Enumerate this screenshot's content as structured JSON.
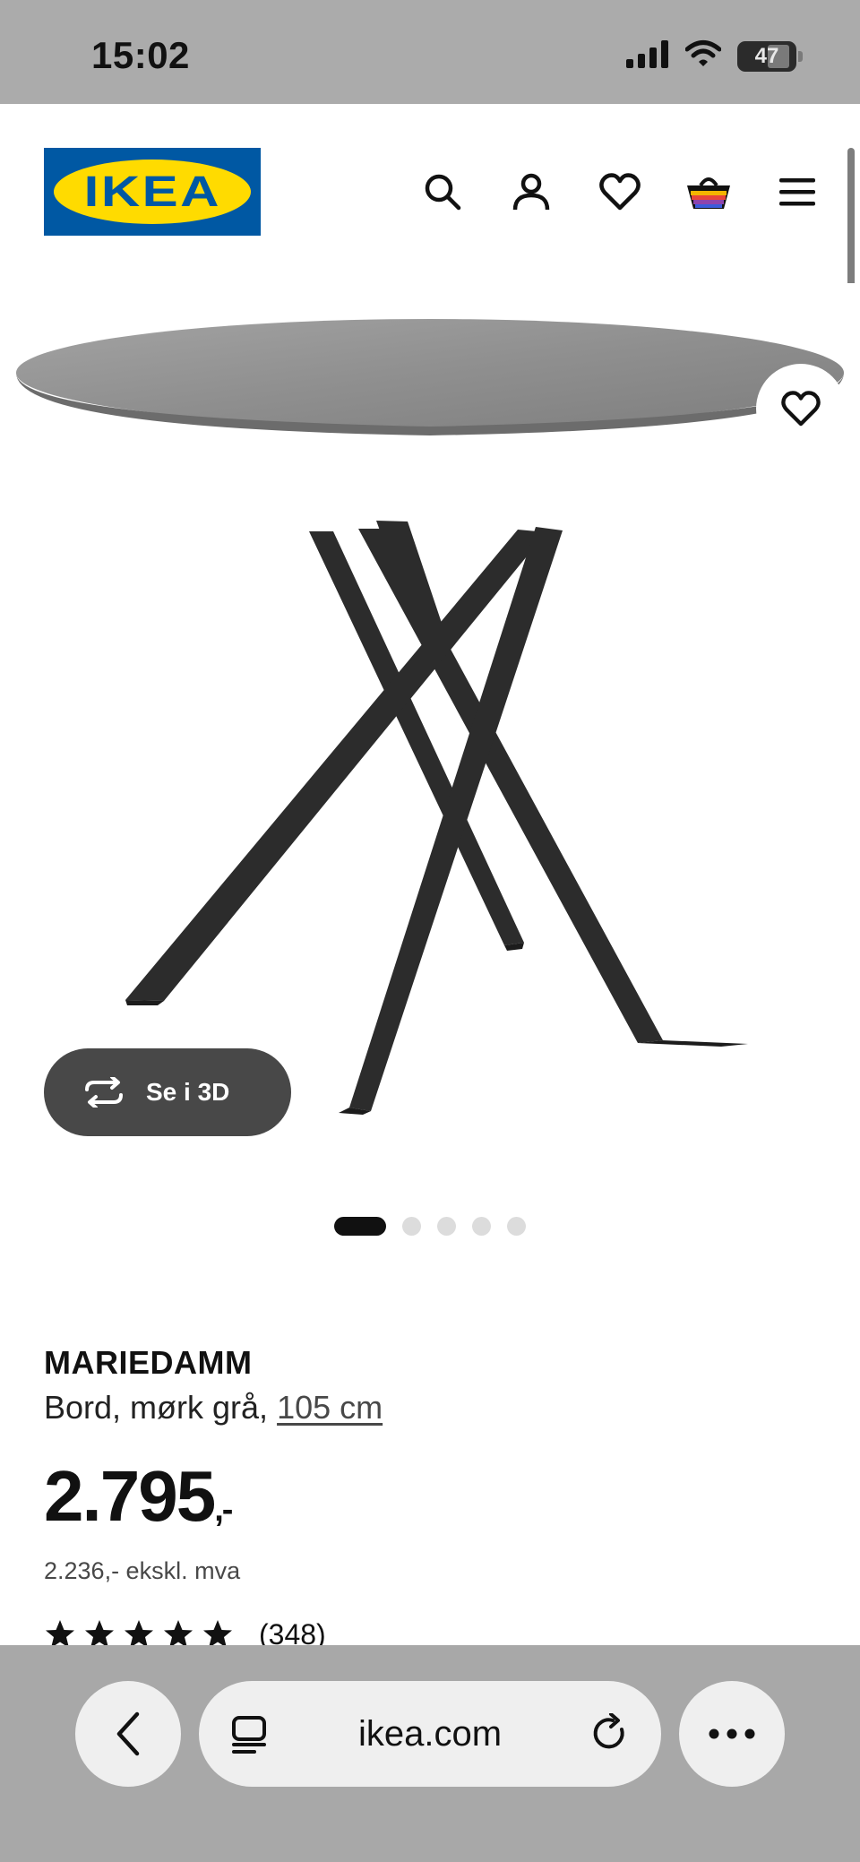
{
  "status_bar": {
    "time": "15:02",
    "battery_level": "47"
  },
  "header": {
    "logo_text": "IKEA",
    "brand_colors": {
      "blue": "#0058a3",
      "yellow": "#ffdb00"
    },
    "icons": [
      "search-icon",
      "user-icon",
      "heart-icon",
      "basket-icon",
      "menu-icon"
    ]
  },
  "product_image": {
    "view_3d_label": "Se i 3D",
    "carousel": {
      "total": 5,
      "active_index": 0
    }
  },
  "product": {
    "name": "MARIEDAMM",
    "description": "Bord, mørk grå, ",
    "size_link": "105 cm",
    "price": "2.795",
    "price_suffix": ",-",
    "price_excl_vat": "2.236,- ekskl. mva",
    "rating": {
      "stars": 5,
      "count": "(348)"
    }
  },
  "browser": {
    "url": "ikea.com"
  }
}
